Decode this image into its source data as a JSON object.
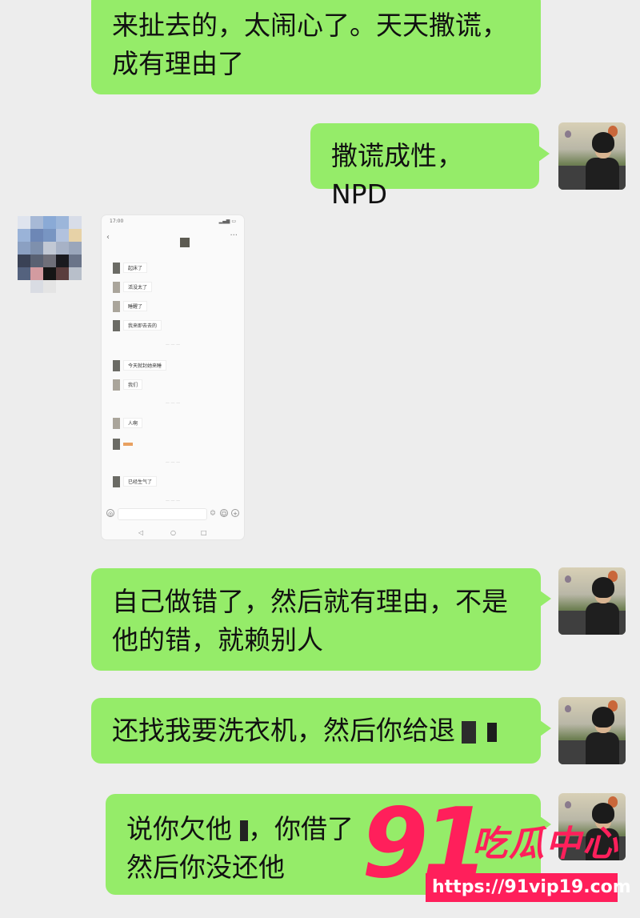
{
  "messages": [
    {
      "lines": [
        "来扯去的，太闹心了。天天撒谎，",
        "成有理由了"
      ]
    },
    {
      "lines": [
        "撒谎成性，NPD"
      ]
    },
    {
      "lines": [
        "自己做错了，然后就有理由，不是",
        "他的错，就赖别人"
      ]
    },
    {
      "lines": [
        "还找我要洗衣机，然后你给退"
      ]
    },
    {
      "lines": [
        "说你欠他",
        "，你借了",
        "然后你没还他"
      ]
    }
  ],
  "screenshot": {
    "status_time": "17:00",
    "messages": [
      "起床了",
      "活没太了",
      "睡醒了",
      "我来即去去的",
      "今天就封她来睡",
      "我们",
      "人啊",
      "已经生气了"
    ]
  },
  "watermark": {
    "number": "91",
    "name": "吃瓜中心",
    "url": "https://91vip19.com"
  },
  "colors": {
    "bubble": "#95ec69",
    "background": "#ededed",
    "brand": "#ff1f5b"
  }
}
